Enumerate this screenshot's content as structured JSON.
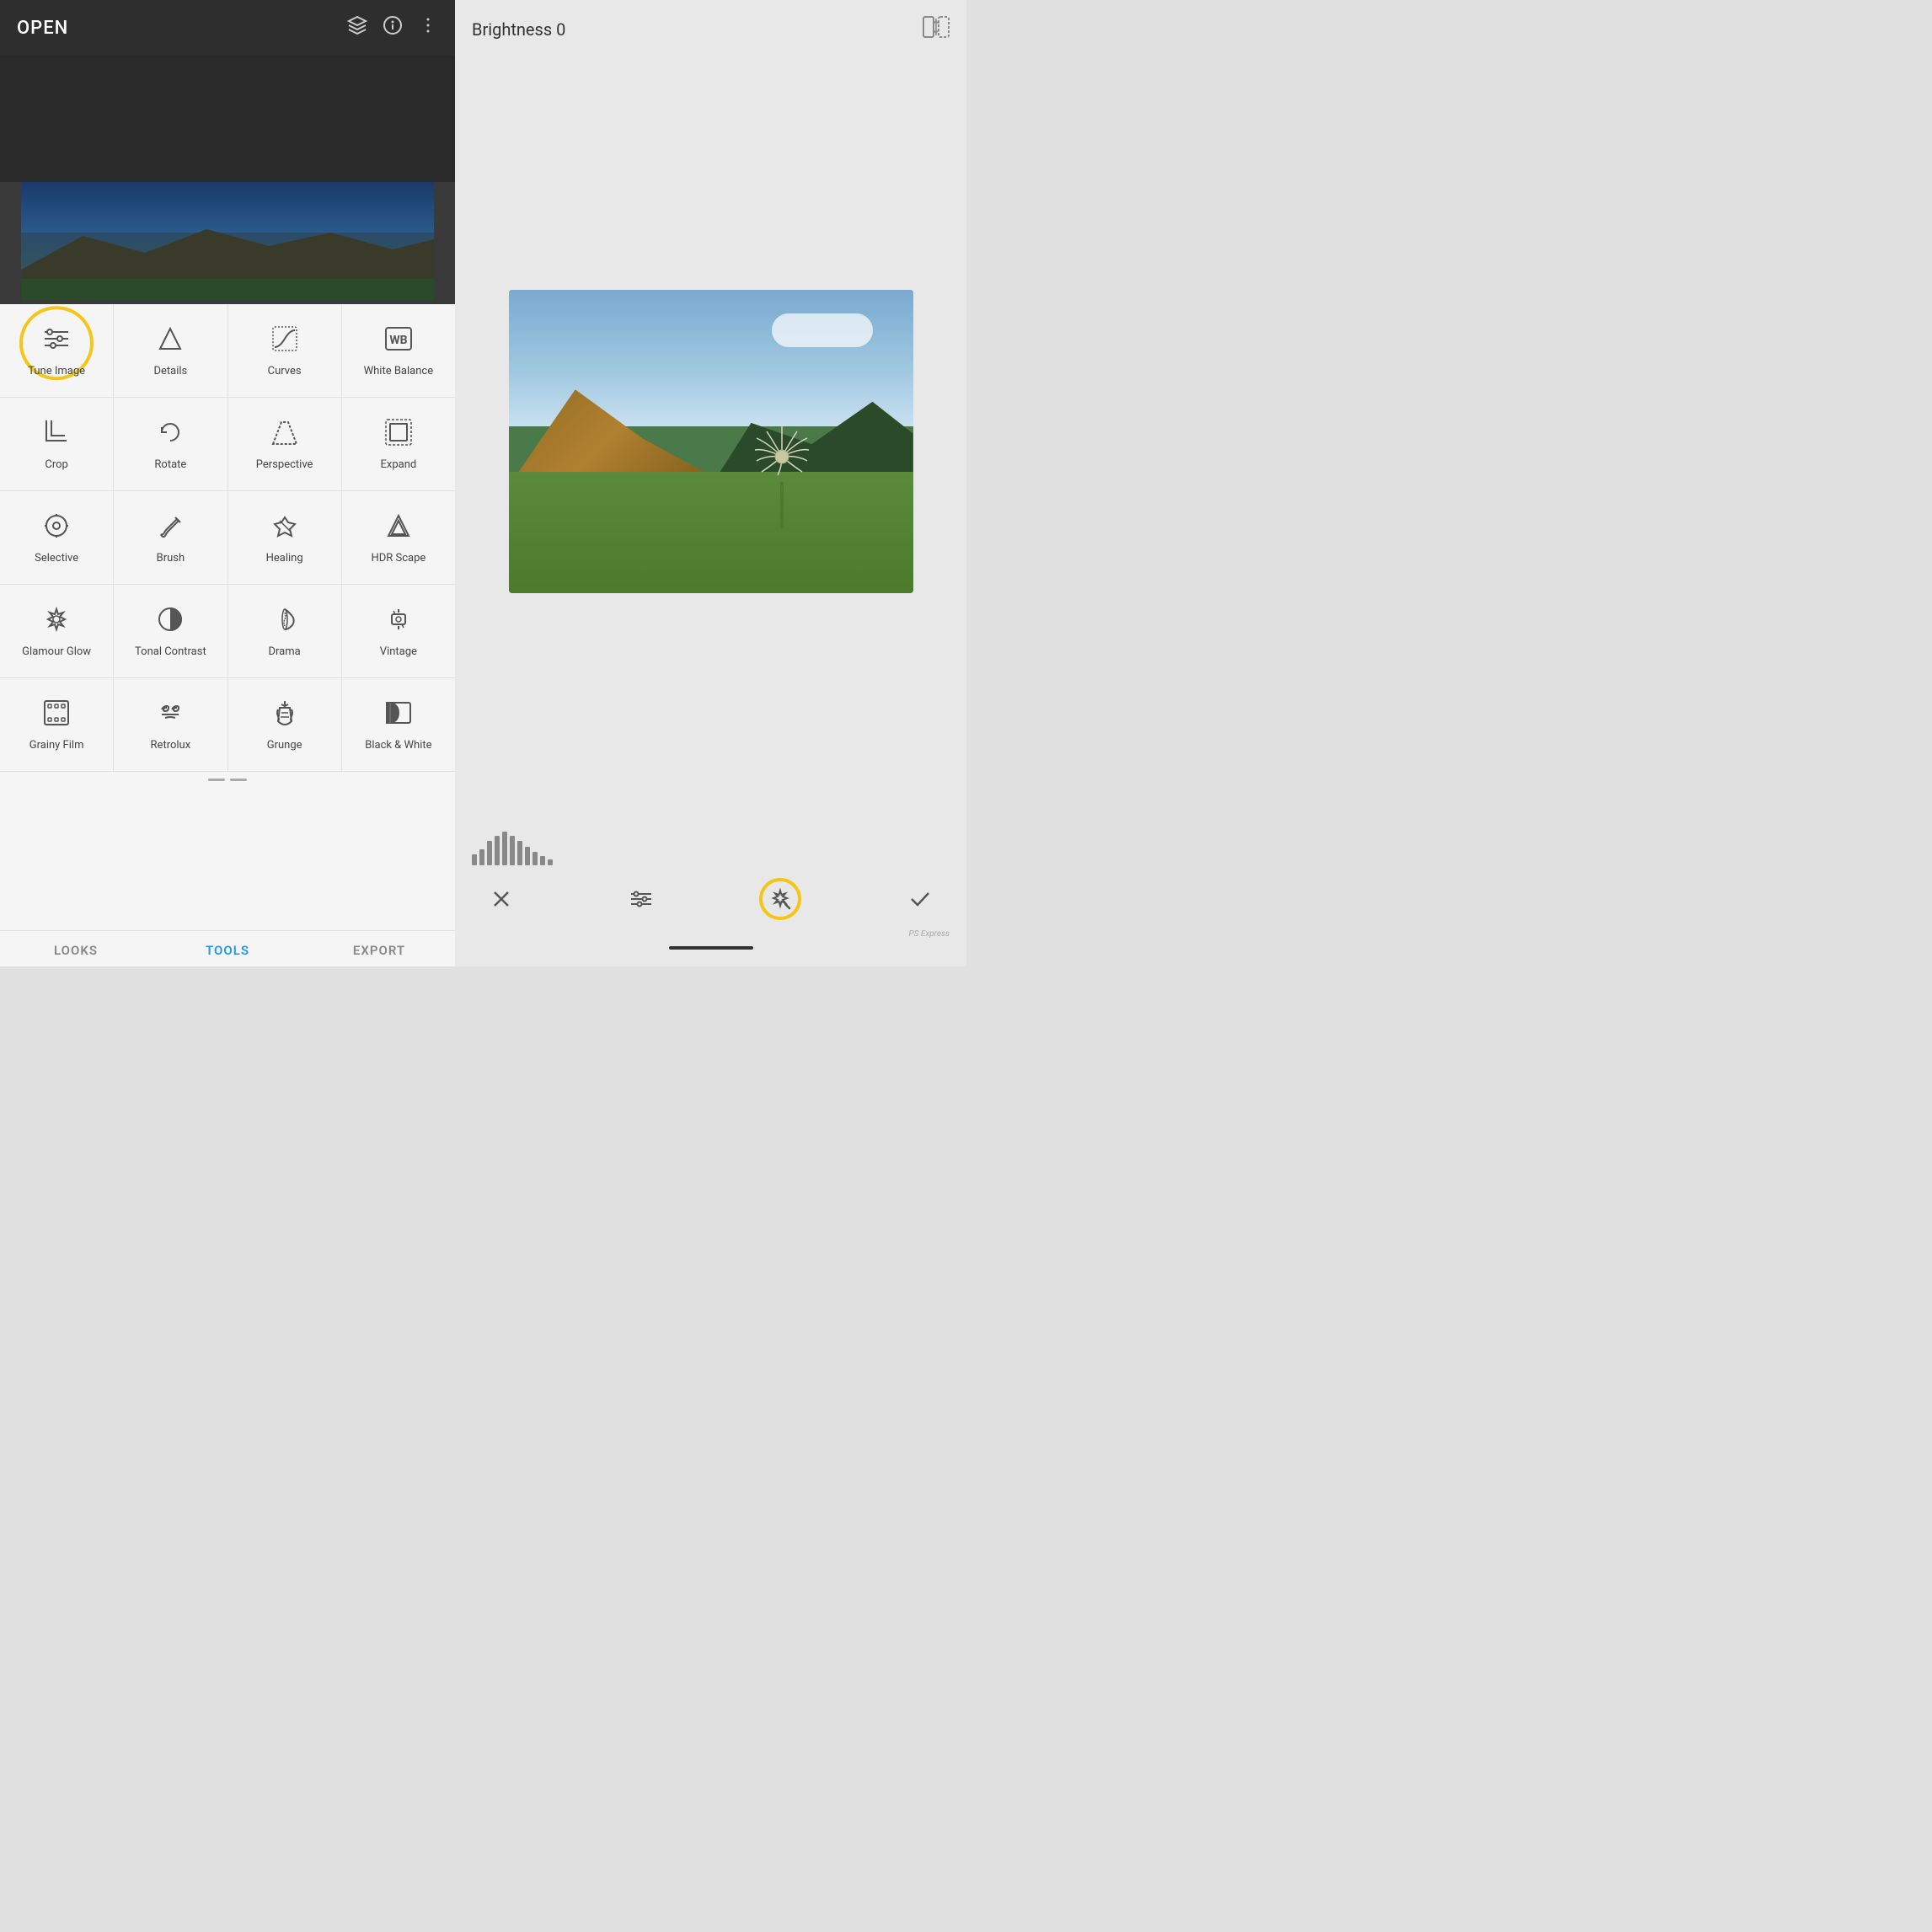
{
  "app": {
    "title": "PS Express"
  },
  "left": {
    "header": {
      "title": "OPEN",
      "icons": [
        "layers",
        "info",
        "more"
      ]
    },
    "tools": [
      [
        {
          "id": "tune-image",
          "label": "Tune Image",
          "icon": "tune",
          "highlighted": true
        },
        {
          "id": "details",
          "label": "Details",
          "icon": "details"
        },
        {
          "id": "curves",
          "label": "Curves",
          "icon": "curves"
        },
        {
          "id": "white-balance",
          "label": "White Balance",
          "icon": "wb"
        }
      ],
      [
        {
          "id": "crop",
          "label": "Crop",
          "icon": "crop"
        },
        {
          "id": "rotate",
          "label": "Rotate",
          "icon": "rotate"
        },
        {
          "id": "perspective",
          "label": "Perspective",
          "icon": "perspective"
        },
        {
          "id": "expand",
          "label": "Expand",
          "icon": "expand"
        }
      ],
      [
        {
          "id": "selective",
          "label": "Selective",
          "icon": "selective"
        },
        {
          "id": "brush",
          "label": "Brush",
          "icon": "brush"
        },
        {
          "id": "healing",
          "label": "Healing",
          "icon": "healing"
        },
        {
          "id": "hdr-scape",
          "label": "HDR Scape",
          "icon": "hdr"
        }
      ],
      [
        {
          "id": "glamour-glow",
          "label": "Glamour Glow",
          "icon": "glamour"
        },
        {
          "id": "tonal-contrast",
          "label": "Tonal Contrast",
          "icon": "tonal"
        },
        {
          "id": "drama",
          "label": "Drama",
          "icon": "drama"
        },
        {
          "id": "vintage",
          "label": "Vintage",
          "icon": "vintage"
        }
      ],
      [
        {
          "id": "grainy-film",
          "label": "Grainy Film",
          "icon": "grainy"
        },
        {
          "id": "retrolux",
          "label": "Retrolux",
          "icon": "retrolux"
        },
        {
          "id": "grunge",
          "label": "Grunge",
          "icon": "grunge"
        },
        {
          "id": "black-white",
          "label": "Black & White",
          "icon": "bw"
        }
      ]
    ],
    "bottom_nav": [
      {
        "id": "looks",
        "label": "LOOKS",
        "active": false
      },
      {
        "id": "tools",
        "label": "TOOLS",
        "active": true
      },
      {
        "id": "export",
        "label": "EXPORT",
        "active": false
      }
    ]
  },
  "right": {
    "header": {
      "brightness_label": "Brightness 0",
      "compare_icon": "compare"
    },
    "action_bar": {
      "cancel_label": "×",
      "adjust_label": "adjust",
      "magic_label": "auto-fix",
      "confirm_label": "✓"
    },
    "histogram": [
      8,
      12,
      18,
      22,
      28,
      32,
      25,
      20,
      15,
      10,
      8
    ]
  }
}
